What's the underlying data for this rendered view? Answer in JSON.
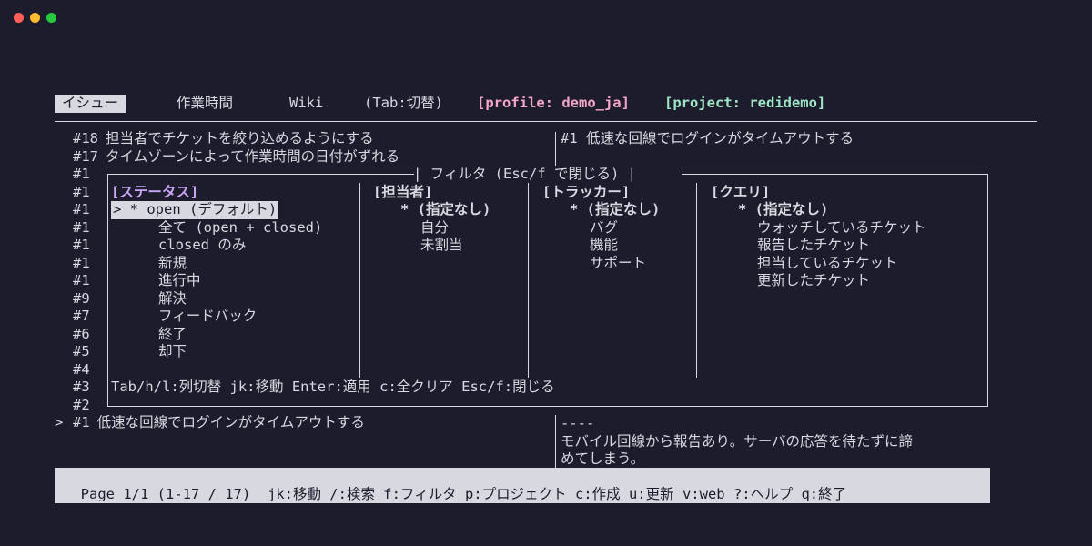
{
  "window": {
    "controls": [
      {
        "name": "close",
        "color": "#ff5f57"
      },
      {
        "name": "minimize",
        "color": "#febc2e"
      },
      {
        "name": "maximize",
        "color": "#28c840"
      }
    ]
  },
  "tabs": [
    {
      "label": "イシュー",
      "active": true
    },
    {
      "label": "作業時間",
      "active": false
    },
    {
      "label": "Wiki",
      "active": false
    }
  ],
  "tab_hint": "(Tab:切替)",
  "profile_label": "[profile: demo_ja]",
  "project_label": "[project: redidemo]",
  "issue_list": [
    {
      "id": "#18",
      "title": "担当者でチケットを絞り込めるようにする"
    },
    {
      "id": "#17",
      "title": "タイムゾーンによって作業時間の日付がずれる"
    },
    {
      "id": "#1",
      "title": ""
    },
    {
      "id": "#1",
      "title": ""
    },
    {
      "id": "#1",
      "title": ""
    },
    {
      "id": "#1",
      "title": ""
    },
    {
      "id": "#1",
      "title": ""
    },
    {
      "id": "#1",
      "title": ""
    },
    {
      "id": "#1",
      "title": ""
    },
    {
      "id": "#9",
      "title": ""
    },
    {
      "id": "#7",
      "title": ""
    },
    {
      "id": "#6",
      "title": ""
    },
    {
      "id": "#5",
      "title": ""
    },
    {
      "id": "#4",
      "title": ""
    },
    {
      "id": "#3",
      "title": ""
    },
    {
      "id": "#2",
      "title": ""
    },
    {
      "id": "#1",
      "title": "低速な回線でログインがタイムアウトする",
      "cursor": ">"
    }
  ],
  "detail": {
    "title": "#1 低速な回線でログインがタイムアウトする",
    "separator": "----",
    "body_line1": "モバイル回線から報告あり。サーバの応答を待たずに諦",
    "body_line2": "めてしまう。"
  },
  "filter": {
    "title": "| フィルタ (Esc/f で閉じる) |",
    "columns": [
      {
        "header": "[ステータス]",
        "items": [
          {
            "label": "> * open (デフォルト)",
            "selected": true
          },
          {
            "label": "全て (open + closed)"
          },
          {
            "label": "closed のみ"
          },
          {
            "label": "新規"
          },
          {
            "label": "進行中"
          },
          {
            "label": "解決"
          },
          {
            "label": "フィードバック"
          },
          {
            "label": "終了"
          },
          {
            "label": "却下"
          }
        ]
      },
      {
        "header": "[担当者]",
        "items": [
          {
            "label": "* (指定なし)",
            "active": true
          },
          {
            "label": "自分"
          },
          {
            "label": "未割当"
          }
        ]
      },
      {
        "header": "[トラッカー]",
        "items": [
          {
            "label": "* (指定なし)",
            "active": true
          },
          {
            "label": "バグ"
          },
          {
            "label": "機能"
          },
          {
            "label": "サポート"
          }
        ]
      },
      {
        "header": "[クエリ]",
        "items": [
          {
            "label": "* (指定なし)",
            "active": true
          },
          {
            "label": "ウォッチしているチケット"
          },
          {
            "label": "報告したチケット"
          },
          {
            "label": "担当しているチケット"
          },
          {
            "label": "更新したチケット"
          }
        ]
      }
    ],
    "help": "Tab/h/l:列切替 jk:移動 Enter:適用 c:全クリア Esc/f:閉じる"
  },
  "status_bar": "Page 1/1 (1-17 / 17)  jk:移動 /:検索 f:フィルタ p:プロジェクト c:作成 u:更新 v:web ?:ヘルプ q:終了"
}
